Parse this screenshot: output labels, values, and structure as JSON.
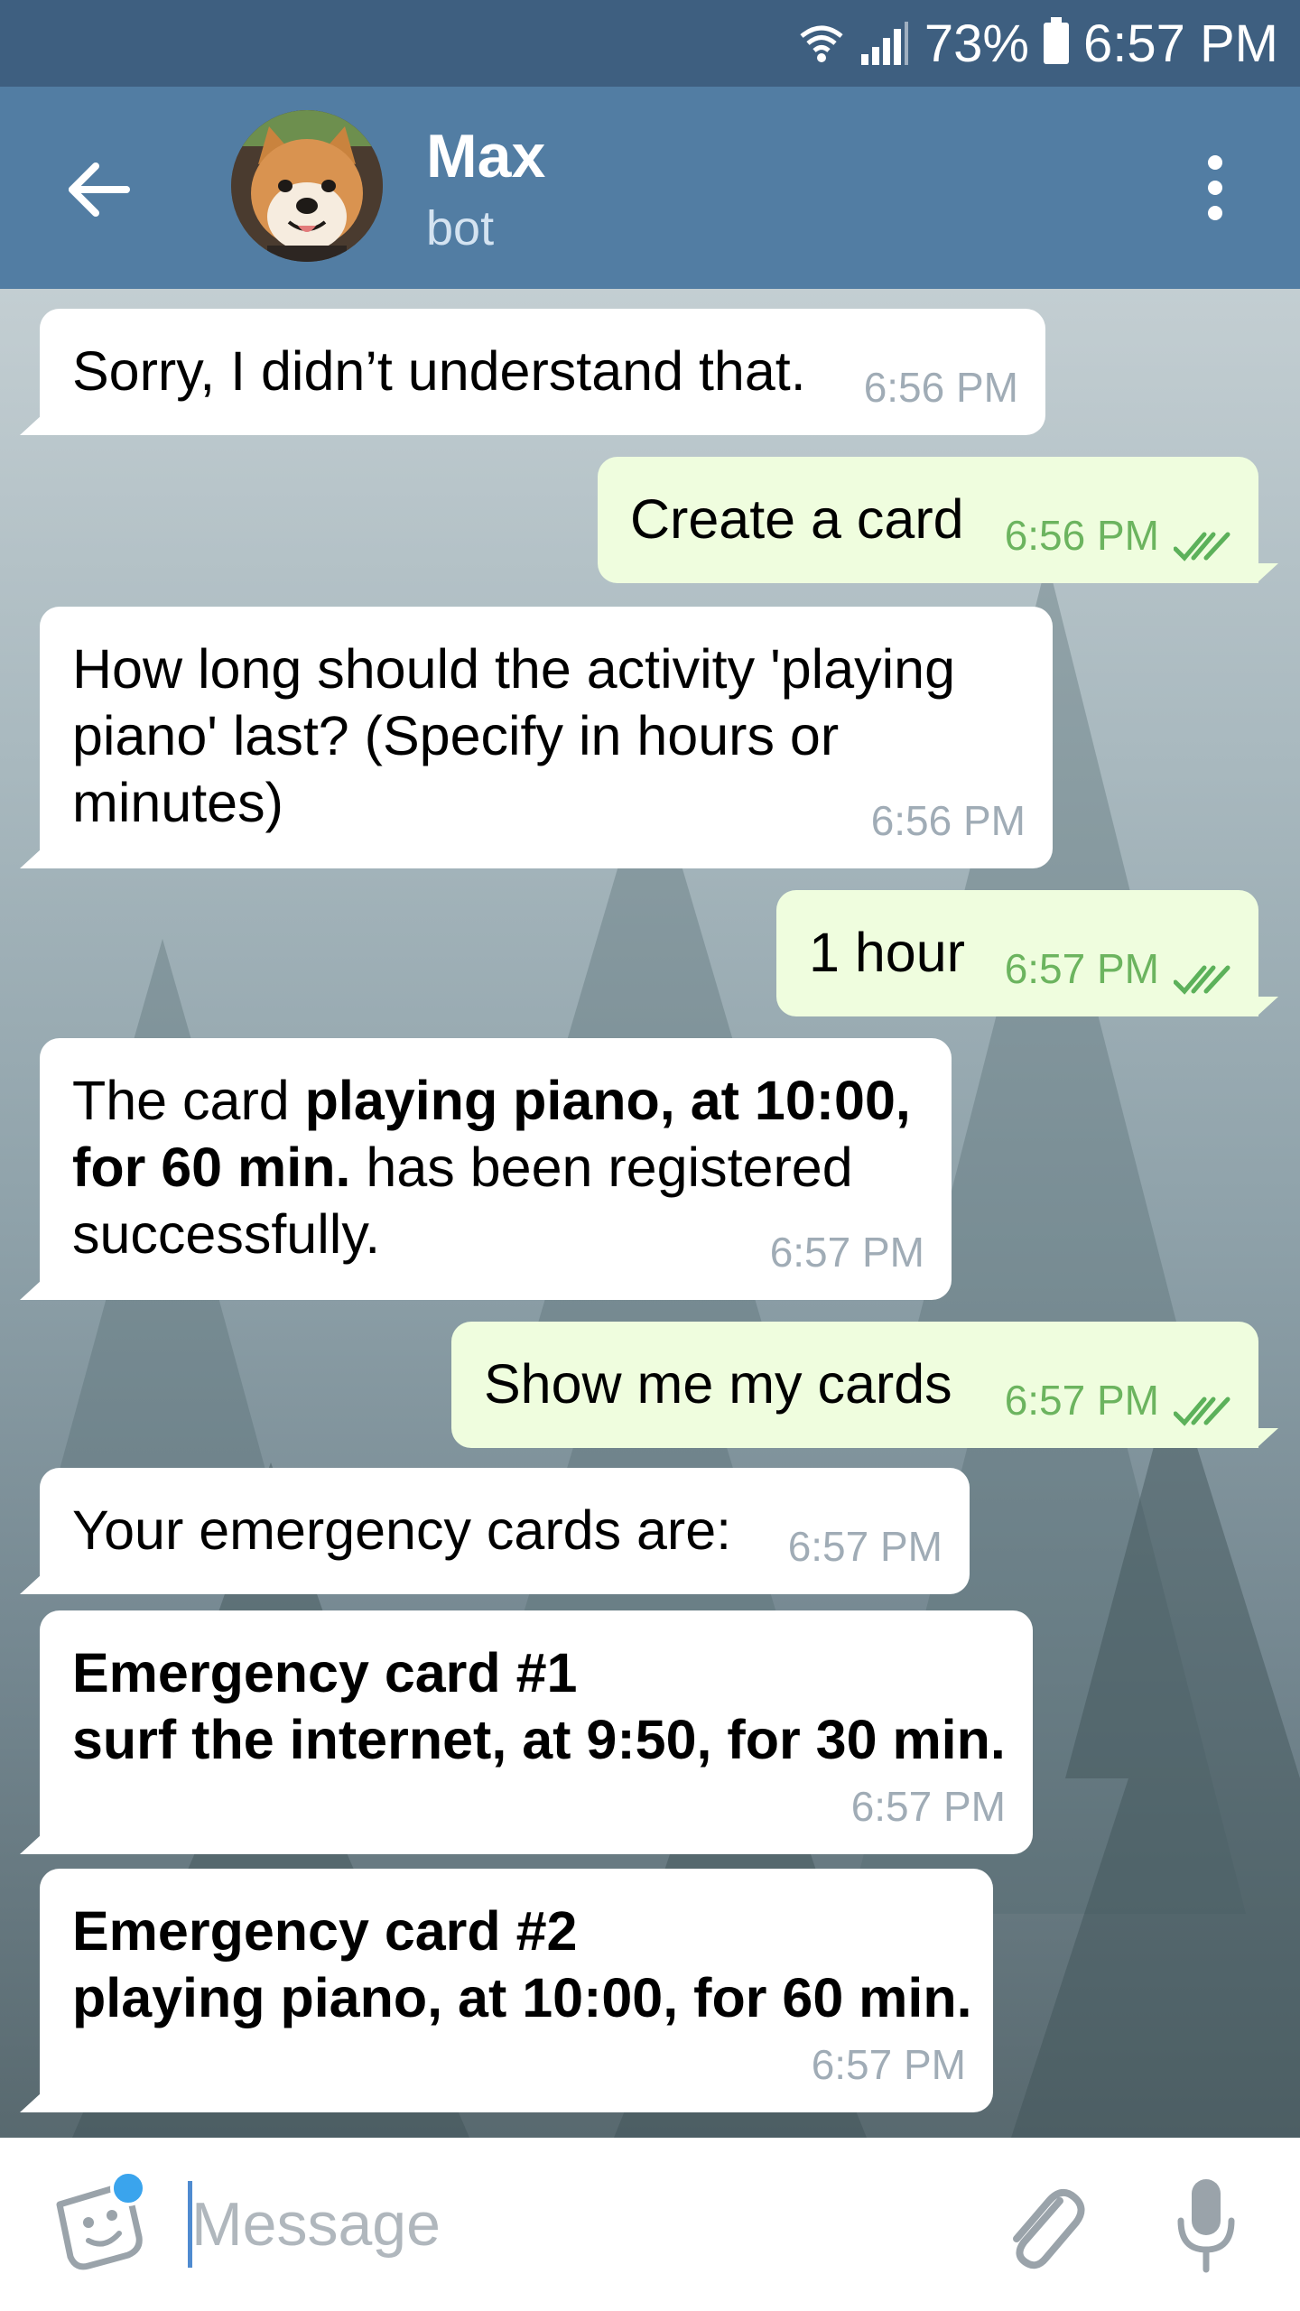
{
  "status_bar": {
    "battery": "73%",
    "time": "6:57 PM",
    "icons": [
      "wifi-icon",
      "signal-icon",
      "battery-icon"
    ]
  },
  "header": {
    "title": "Max",
    "subtitle": "bot",
    "icons": [
      "back-arrow-icon",
      "avatar",
      "more-vert-icon"
    ]
  },
  "messages": [
    {
      "direction": "in",
      "text": "Sorry, I didn’t understand that.",
      "time": "6:56 PM"
    },
    {
      "direction": "out",
      "text": "Create a card",
      "time": "6:56 PM",
      "read": true
    },
    {
      "direction": "in",
      "lines": [
        "How long should the activity 'playing",
        "piano' last? (Specify in hours or",
        "minutes)"
      ],
      "time": "6:56 PM"
    },
    {
      "direction": "out",
      "text": "1 hour",
      "time": "6:57 PM",
      "read": true
    },
    {
      "direction": "in",
      "parts": {
        "prefix": "The card ",
        "bold1": "playing piano, at 10:00,",
        "bold2": "for 60 min.",
        "suffix2": " has been registered",
        "line3": "successfully."
      },
      "time": "6:57 PM"
    },
    {
      "direction": "out",
      "text": "Show me my cards",
      "time": "6:57 PM",
      "read": true
    },
    {
      "direction": "in",
      "text": "Your emergency cards are:",
      "time": "6:57 PM"
    },
    {
      "direction": "in",
      "lines": [
        "Emergency card #1",
        "surf the internet, at 9:50, for 30 min."
      ],
      "bold": true,
      "time": "6:57 PM"
    },
    {
      "direction": "in",
      "lines": [
        "Emergency card #2",
        "playing piano, at 10:00, for 60 min."
      ],
      "bold": true,
      "time": "6:57 PM"
    }
  ],
  "input": {
    "placeholder": "Message",
    "value": ""
  },
  "colors": {
    "status_bar": "#3e5f80",
    "header": "#527da3",
    "incoming_bubble": "#ffffff",
    "outgoing_bubble": "#effdde",
    "outgoing_time": "#6cb45f",
    "incoming_time": "#a0acb6",
    "sticker_dot": "#3aa4ed"
  }
}
